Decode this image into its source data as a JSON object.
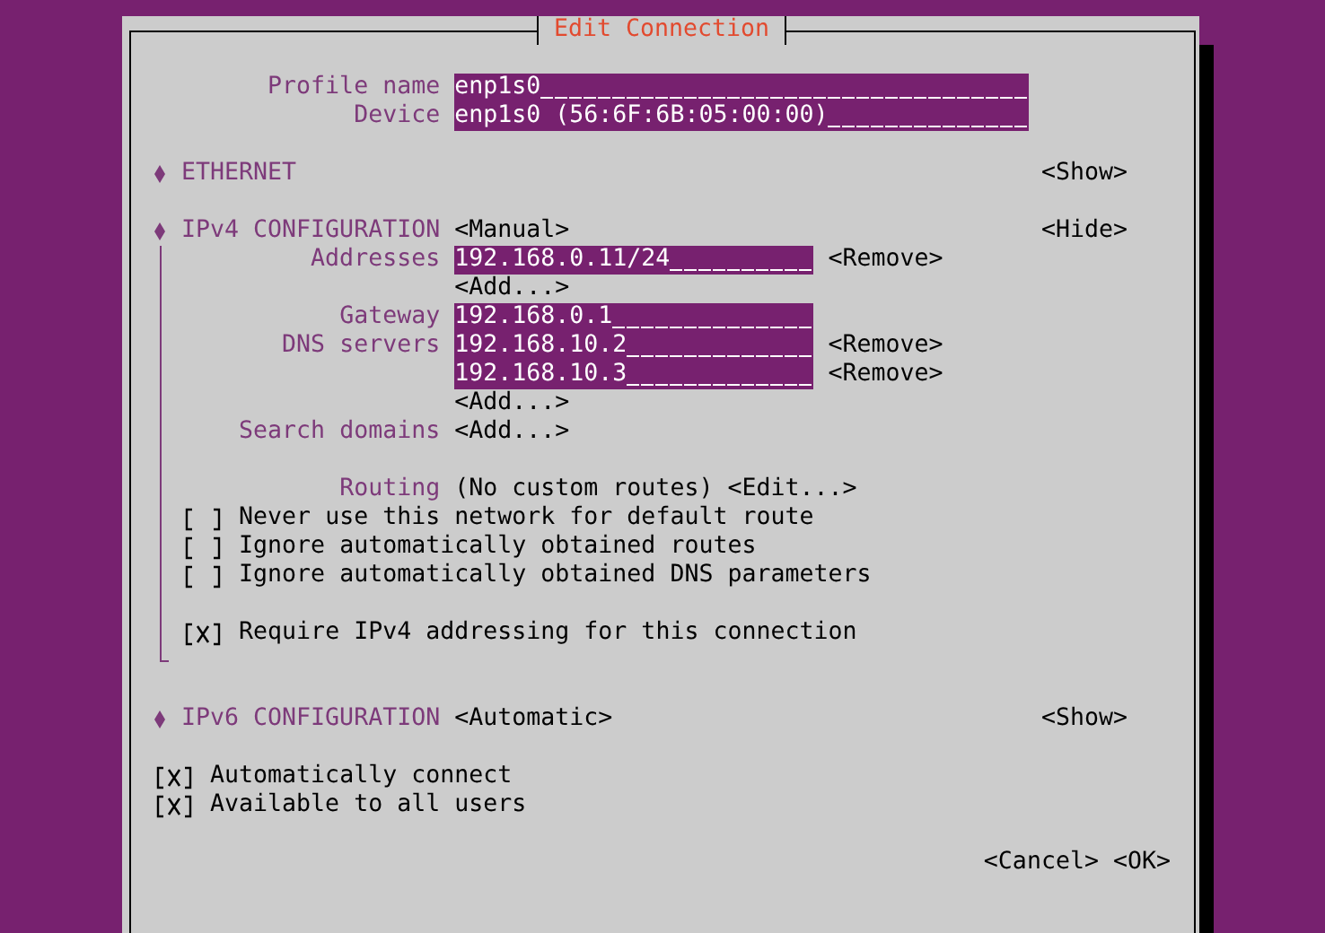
{
  "window": {
    "title": "Edit Connection"
  },
  "profile_name": {
    "label": "Profile name",
    "value": "enp1s0"
  },
  "device": {
    "label": "Device",
    "value": "enp1s0 (56:6F:6B:05:00:00)"
  },
  "ethernet": {
    "label": "ETHERNET",
    "toggle": "<Show>",
    "expanded": false
  },
  "ipv4": {
    "label": "IPv4 CONFIGURATION",
    "mode": "<Manual>",
    "toggle": "<Hide>",
    "expanded": true,
    "addresses": {
      "label": "Addresses",
      "entries": [
        {
          "value": "192.168.0.11/24",
          "remove": "<Remove>"
        }
      ],
      "add": "<Add...>"
    },
    "gateway": {
      "label": "Gateway",
      "value": "192.168.0.1"
    },
    "dns_servers": {
      "label": "DNS servers",
      "entries": [
        {
          "value": "192.168.10.2",
          "remove": "<Remove>"
        },
        {
          "value": "192.168.10.3",
          "remove": "<Remove>"
        }
      ],
      "add": "<Add...>"
    },
    "search_domains": {
      "label": "Search domains",
      "add": "<Add...>"
    },
    "routing": {
      "label": "Routing",
      "value": "(No custom routes)",
      "edit": "<Edit...>"
    },
    "options": [
      {
        "label": "Never use this network for default route",
        "checked": false
      },
      {
        "label": "Ignore automatically obtained routes",
        "checked": false
      },
      {
        "label": "Ignore automatically obtained DNS parameters",
        "checked": false
      }
    ],
    "require": {
      "label": "Require IPv4 addressing for this connection",
      "checked": true
    }
  },
  "ipv6": {
    "label": "IPv6 CONFIGURATION",
    "mode": "<Automatic>",
    "toggle": "<Show>",
    "expanded": false
  },
  "general_options": [
    {
      "label": "Automatically connect",
      "checked": true
    },
    {
      "label": "Available to all users",
      "checked": true
    }
  ],
  "buttons": [
    "<Cancel>",
    "<OK>"
  ]
}
